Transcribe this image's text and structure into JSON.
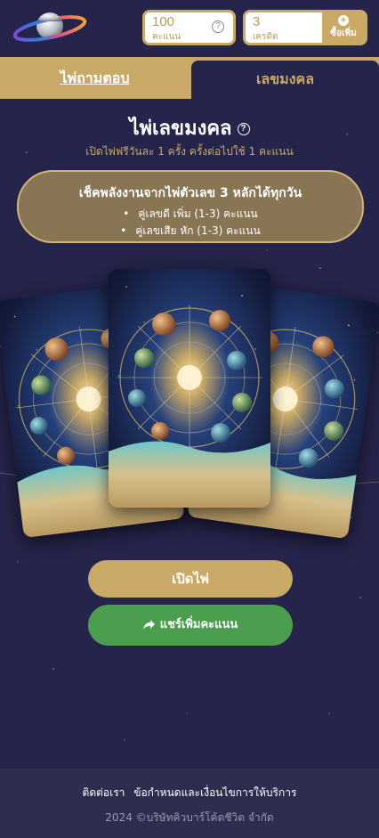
{
  "header": {
    "points": {
      "value": "100",
      "unit": "คะแนน",
      "help_icon": "question-circle-icon"
    },
    "credit": {
      "value": "3",
      "unit": "เครดิต"
    },
    "buy_button": {
      "label": "ซื้อเพิ่ม",
      "icon": "plus-circle-icon"
    }
  },
  "tabs": [
    {
      "label": "ไพ่ถามตอบ",
      "active": false
    },
    {
      "label": "เลขมงคล",
      "active": true
    }
  ],
  "main": {
    "title": "ไพ่เลขมงคล",
    "title_help": "?",
    "subtitle": "เปิดไพ่ฟรีวันละ 1 ครั้ง ครั้งต่อไปใช้ 1 คะแนน",
    "info": {
      "heading": "เช็คพลังงานจากไพ่ตัวเลข 3 หลักได้ทุกวัน",
      "items": [
        "คู่เลขดี เพิ่ม (1-3) คะแนน",
        "คู่เลขเสีย หัก (1-3) คะแนน"
      ]
    },
    "open_button": "เปิดไพ่",
    "share_button": "แชร์เพิ่มคะแนน"
  },
  "footer": {
    "contact": "ติดต่อเรา",
    "terms": "ข้อกำหนดและเงื่อนไขการให้บริการ",
    "copyright": "2024 ©บริษัทคิวบาร์โค้ดชีวิต จำกัด"
  },
  "colors": {
    "background": "#25244a",
    "gold": "#c9a966",
    "info_box": "#887554",
    "share_green": "#4a9e4e",
    "footer": "#2e2d4f"
  }
}
